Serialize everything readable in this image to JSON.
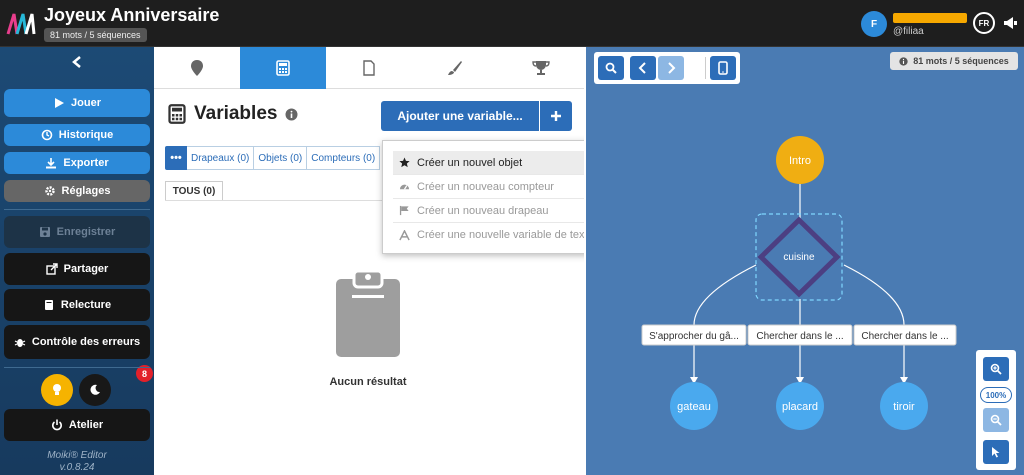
{
  "header": {
    "title": "Joyeux Anniversaire",
    "badge": "81 mots / 5 séquences",
    "avatar_initial": "F",
    "username": "@filiaa",
    "lang": "FR"
  },
  "sidebar": {
    "buttons": {
      "play": "Jouer",
      "history": "Historique",
      "export": "Exporter",
      "settings": "Réglages",
      "save": "Enregistrer",
      "share": "Partager",
      "review": "Relecture",
      "errors": "Contrôle des erreurs",
      "workshop": "Atelier"
    },
    "errors_count": "8",
    "editor_name": "Moiki® Editor",
    "editor_version": "v.0.8.24"
  },
  "panel": {
    "tabs": [
      "map-pin-icon",
      "calculator-icon",
      "file-icon",
      "brush-icon",
      "trophy-icon"
    ],
    "active_tab": 1,
    "title": "Variables",
    "add_button": "Ajouter une variable...",
    "filters": {
      "flags": "Drapeaux (0)",
      "objects": "Objets (0)",
      "counters": "Compteurs (0)"
    },
    "all_tab": "TOUS (0)",
    "empty_text": "Aucun résultat"
  },
  "dropdown": {
    "items": [
      {
        "label": "Créer un nouvel objet",
        "icon": "star-icon"
      },
      {
        "label": "Créer un nouveau compteur",
        "icon": "gauge-icon"
      },
      {
        "label": "Créer un nouveau drapeau",
        "icon": "flag-icon"
      },
      {
        "label": "Créer une nouvelle variable de texte",
        "icon": "text-icon"
      }
    ]
  },
  "graph": {
    "badge": "81 mots / 5 séquences",
    "zoom": "100%",
    "nodes": {
      "intro": "Intro",
      "kitchen": "cuisine",
      "cake": "gateau",
      "cupboard": "placard",
      "drawer": "tiroir"
    },
    "choices": {
      "c1": "S'approcher du gâ...",
      "c2": "Chercher dans le ...",
      "c3": "Chercher dans le ..."
    },
    "colors": {
      "background": "#4a7bb3",
      "intro": "#f0ae12",
      "node": "#4aa9ee",
      "diamond": "#4c3f82"
    }
  }
}
